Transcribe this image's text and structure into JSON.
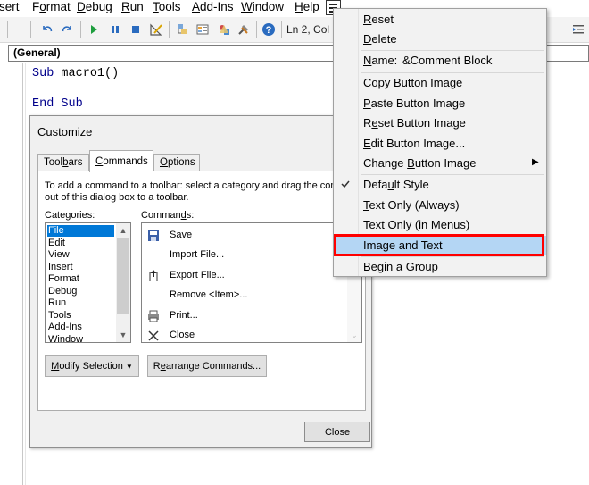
{
  "menubar": {
    "items": [
      {
        "label": "sert",
        "accent": ""
      },
      {
        "label": "Format",
        "accent": "o"
      },
      {
        "label": "Debug",
        "accent": "D"
      },
      {
        "label": "Run",
        "accent": "R"
      },
      {
        "label": "Tools",
        "accent": "T"
      },
      {
        "label": "Add-Ins",
        "accent": "A"
      },
      {
        "label": "Window",
        "accent": "W"
      },
      {
        "label": "Help",
        "accent": "H"
      }
    ]
  },
  "toolbar": {
    "icons": [
      "undo-icon",
      "redo-icon",
      "run-icon",
      "break-icon",
      "reset-icon",
      "design-mode-icon",
      "project-explorer-icon",
      "properties-icon",
      "object-browser-icon",
      "toolbox-icon",
      "help-icon"
    ],
    "status": "Ln 2, Col"
  },
  "editor": {
    "procedure_combo": "(General)",
    "lines": [
      {
        "kw": "Sub",
        "rest": " macro1()"
      },
      {
        "kw": "End Sub",
        "rest": ""
      }
    ]
  },
  "dialog": {
    "title": "Customize",
    "tabs": [
      {
        "pre": "Tool",
        "acc": "b",
        "post": "ars"
      },
      {
        "pre": "",
        "acc": "C",
        "post": "ommands"
      },
      {
        "pre": "",
        "acc": "O",
        "post": "ptions"
      }
    ],
    "instructions": [
      "To add a command to a toolbar: select a category and drag the com",
      "out of this dialog box to a toolbar."
    ],
    "categories_label": "Categories:",
    "commands_label": {
      "pre": "Comman",
      "acc": "d",
      "post": "s:"
    },
    "categories": [
      "File",
      "Edit",
      "View",
      "Insert",
      "Format",
      "Debug",
      "Run",
      "Tools",
      "Add-Ins",
      "Window"
    ],
    "selected_category": "File",
    "commands": [
      {
        "label": "Save",
        "icon": "save-icon"
      },
      {
        "label": "Import File...",
        "icon": ""
      },
      {
        "label": "Export File...",
        "icon": "export-file-icon"
      },
      {
        "label": "Remove <Item>...",
        "icon": ""
      },
      {
        "label": "Print...",
        "icon": "print-icon"
      },
      {
        "label": "Close",
        "icon": "close-icon"
      }
    ],
    "modify_selection": {
      "pre": "",
      "acc": "M",
      "post": "odify Selection"
    },
    "rearrange": {
      "pre": "R",
      "acc": "e",
      "post": "arrange Commands..."
    },
    "close": "Close"
  },
  "context_menu": {
    "items": [
      {
        "label": "Reset",
        "acc": "R"
      },
      {
        "label": "Delete",
        "acc": "D"
      },
      {
        "label": "Name:",
        "acc": "N",
        "value": "&Comment Block"
      },
      {
        "label": "Copy Button Image",
        "acc": "C"
      },
      {
        "label": "Paste Button Image",
        "acc": "P"
      },
      {
        "label": "Reset Button Image",
        "acc": "e"
      },
      {
        "label": "Edit Button Image...",
        "acc": "E"
      },
      {
        "label": "Change Button Image",
        "acc": "B"
      },
      {
        "label": "Default Style",
        "acc": "u"
      },
      {
        "label": "Text Only (Always)",
        "acc": "T"
      },
      {
        "label": "Text Only (in Menus)",
        "acc": "O"
      },
      {
        "label": "Image and Text",
        "acc": "A"
      },
      {
        "label": "Begin a Group",
        "acc": "G"
      }
    ],
    "checked": "Default Style",
    "highlighted": "Image and Text",
    "highlight_color": "#b4d6f4",
    "annotation_color": "#ff0000"
  }
}
